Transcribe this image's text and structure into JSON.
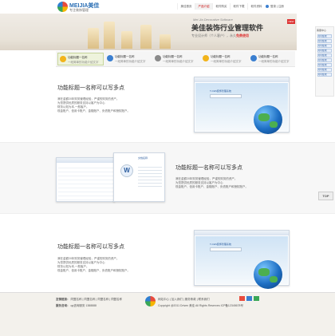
{
  "header": {
    "brand": "MEIJIA美佳",
    "tagline": "专注装饰管理",
    "badge": "美佳",
    "nav": [
      "美佳首页",
      "产品介绍",
      "软件购买",
      "软件下载",
      "软件资料"
    ],
    "nav_active": 1,
    "login": "登录 | 注册"
  },
  "banner": {
    "subtitle": "Mei Jia Decorative Software",
    "title": "美佳装饰行业管理软件",
    "slogan_pre": "专业设计师（个人客户），永久",
    "slogan_highlight": "免费使用",
    "new_badge": "NEW"
  },
  "side": {
    "title": "客服中心",
    "items": [
      "QQ在线",
      "QQ在线",
      "QQ在线",
      "QQ在线",
      "QQ在线",
      "QQ在线",
      "QQ在线",
      "QQ在线",
      "QQ在线"
    ]
  },
  "tabs": [
    {
      "title": "功能标题一名称",
      "desc": "一段简单的功能介绍文字",
      "color": "#f2b41b"
    },
    {
      "title": "功能标题一名称",
      "desc": "一段简单的功能介绍文字",
      "color": "#3b7fd0"
    },
    {
      "title": "功能标题一名称",
      "desc": "一段简单的功能介绍文字",
      "color": "#8a8a8a"
    },
    {
      "title": "功能标题一名称",
      "desc": "一段简单的功能介绍文字",
      "color": "#f2b41b"
    },
    {
      "title": "功能标题一名称",
      "desc": "一段简单的功能介绍文字",
      "color": "#3b7fd0"
    }
  ],
  "features": [
    {
      "title": "功能标题一名称可以写多点",
      "text": "滴在金额20年财务管理经验，严谨的财务的资产。\n为您提供优质的服务支持以客户为中心\n财务以知为本,一般客户。\n现金账户、信用卡账户、金融账户、负债账户和授权账户。",
      "app_title": "T-CES装饰管理系统"
    },
    {
      "title": "功能标题一名称可以写多点",
      "text": "滴在金额20年财务管理经验，严谨的财务的资产。\n为您提供优质的服务支持以客户为中心\n现金账户、信用卡账户、金融账户、负债账户和授权账户。",
      "app_title": "文档名称"
    },
    {
      "title": "功能标题一名称可以写多点",
      "text": "滴在金额20年财务管理经验，严谨的财务的资产。\n为您提供优质的服务支持以客户为中心\n财务以知为本,一般客户。\n现金账户、信用卡账户、金融账户、负债账户和授权账户。",
      "app_title": "T-CES装饰管理系统"
    }
  ],
  "footer": {
    "row1_label": "友情链接：",
    "row1_links": [
      "同盟名称",
      "同盟名称",
      "同盟名称",
      "同盟名称",
      "同盟名称",
      "同盟名称"
    ],
    "row2_label": "服务咨询：",
    "row2_items": [
      "qq咨询服务",
      "1388888"
    ],
    "links": [
      "网站中心",
      "加入我们",
      "服务条款",
      "联系我们"
    ],
    "copyright": "Copyright @2011 Driven 美佳 All Rights Reserves",
    "icp": "ICP备12345678号"
  },
  "top_label": "TOP"
}
